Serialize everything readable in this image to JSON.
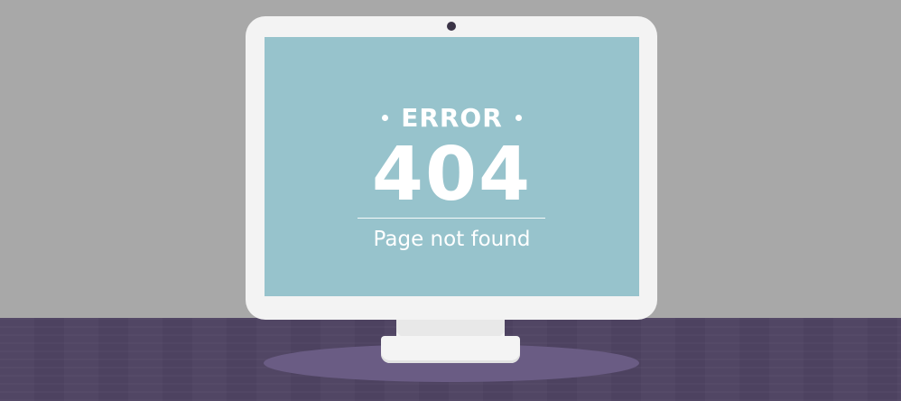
{
  "error": {
    "label": "ERROR",
    "code": "404",
    "message": "Page not found"
  },
  "colors": {
    "wall": "#a8a8a8",
    "desk": "#4d4260",
    "screen": "#97c3cc",
    "bezel": "#f3f3f3",
    "text": "#ffffff"
  },
  "icons": {
    "camera": "webcam-dot"
  }
}
